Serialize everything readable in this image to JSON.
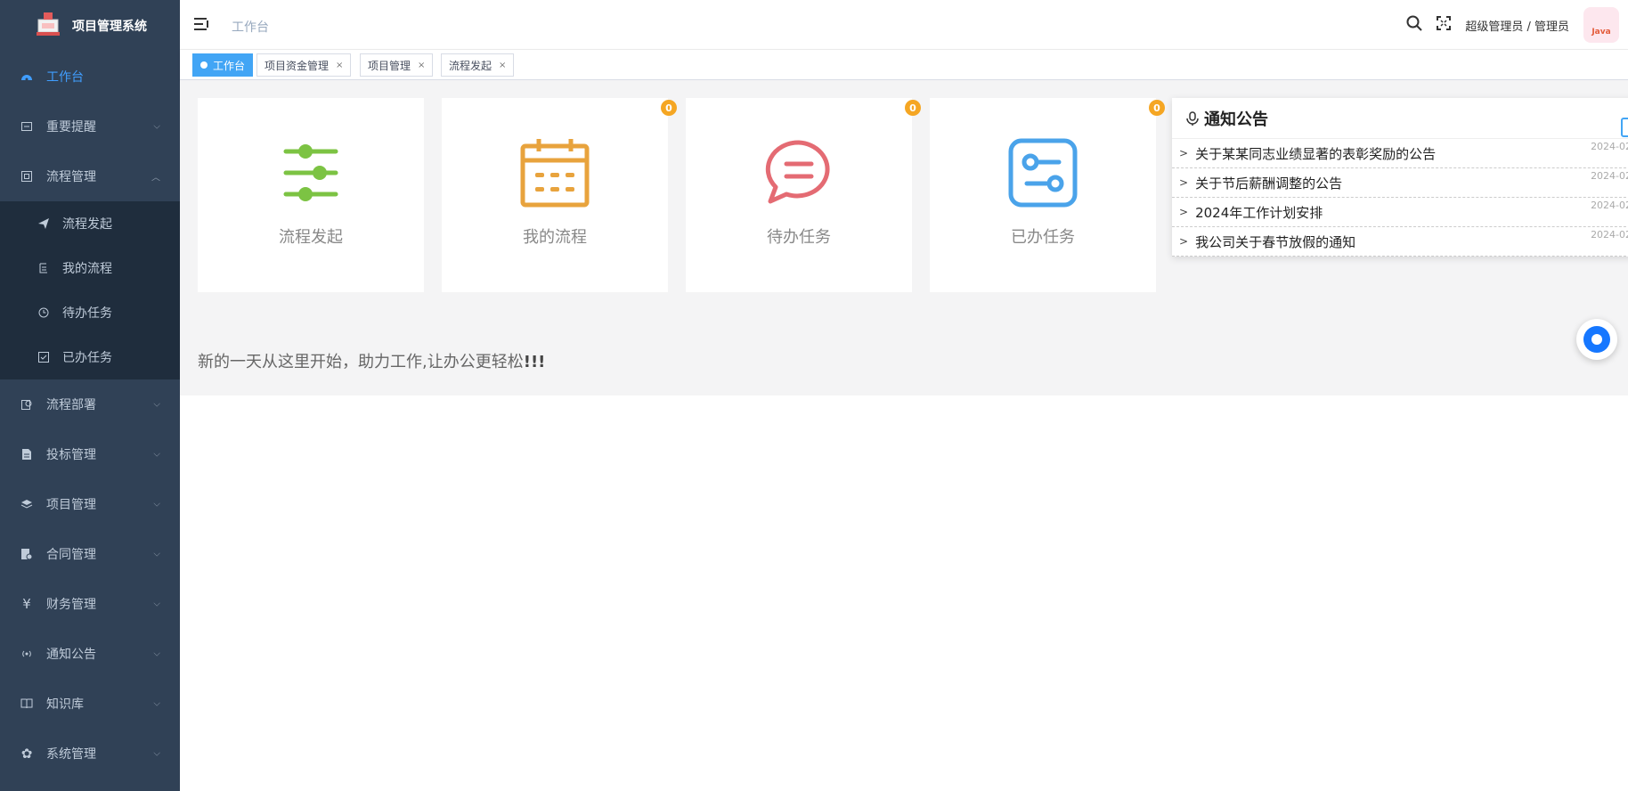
{
  "app": {
    "title": "项目管理系统"
  },
  "sidebar": {
    "items": [
      {
        "label": "工作台",
        "icon": "dashboard-icon",
        "active": true
      },
      {
        "label": "重要提醒",
        "icon": "reminder-icon"
      },
      {
        "label": "流程管理",
        "icon": "process-icon",
        "expanded": true,
        "children": [
          {
            "label": "流程发起",
            "icon": "send-icon"
          },
          {
            "label": "我的流程",
            "icon": "my-process-icon"
          },
          {
            "label": "待办任务",
            "icon": "todo-icon"
          },
          {
            "label": "已办任务",
            "icon": "done-icon"
          }
        ]
      },
      {
        "label": "流程部署",
        "icon": "deploy-icon"
      },
      {
        "label": "投标管理",
        "icon": "bid-icon"
      },
      {
        "label": "项目管理",
        "icon": "project-icon"
      },
      {
        "label": "合同管理",
        "icon": "contract-icon"
      },
      {
        "label": "财务管理",
        "icon": "yen-icon"
      },
      {
        "label": "通知公告",
        "icon": "broadcast-icon"
      },
      {
        "label": "知识库",
        "icon": "book-icon"
      },
      {
        "label": "系统管理",
        "icon": "gear-icon"
      }
    ]
  },
  "header": {
    "breadcrumb": "工作台",
    "user": "超级管理员 / 管理员",
    "avatar_text": "Java"
  },
  "tags": [
    {
      "label": "工作台",
      "active": true
    },
    {
      "label": "项目资金管理",
      "close": "×"
    },
    {
      "label": "项目管理",
      "close": "×"
    },
    {
      "label": "流程发起",
      "close": "×"
    }
  ],
  "cards": [
    {
      "label": "流程发起",
      "color": "#7cc343",
      "icon": "sliders-icon"
    },
    {
      "label": "我的流程",
      "color": "#e8a33d",
      "icon": "calendar-icon",
      "badge": "0"
    },
    {
      "label": "待办任务",
      "color": "#e46b73",
      "icon": "chat-icon",
      "badge": "0"
    },
    {
      "label": "已办任务",
      "color": "#4aa3ea",
      "icon": "settings-panel-icon",
      "badge": "0"
    }
  ],
  "welcome": {
    "text": "新的一天从这里开始，助力工作,让办公更轻松",
    "exclaim": "!!!"
  },
  "notice": {
    "title": "通知公告",
    "items": [
      {
        "title": "关于某某同志业绩显著的表彰奖励的公告",
        "date": "2024-02-"
      },
      {
        "title": "关于节后薪酬调整的公告",
        "date": "2024-02-"
      },
      {
        "title": "2024年工作计划安排",
        "date": "2024-02-"
      },
      {
        "title": "我公司关于春节放假的通知",
        "date": "2024-02-"
      }
    ]
  }
}
